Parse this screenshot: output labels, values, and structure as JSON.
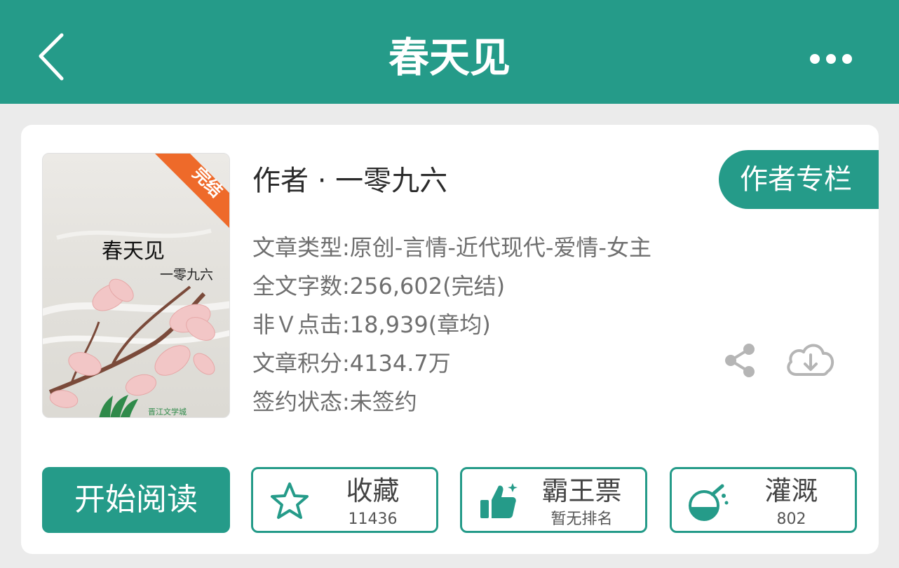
{
  "header": {
    "title": "春天见"
  },
  "book": {
    "cover_title": "春天见",
    "cover_author": "一零九六",
    "cover_status_ribbon": "完结",
    "cover_publisher_logo": "晋江文学城",
    "author_line": "作者 · 一零九六",
    "author_column_button": "作者专栏",
    "meta": {
      "genre": "文章类型:原创-言情-近代现代-爱情-女主",
      "word_count": "全文字数:256,602(完结)",
      "clicks": "非Ｖ点击:18,939(章均)",
      "score": "文章积分:4134.7万",
      "contract": "签约状态:未签约"
    }
  },
  "actions": {
    "read_label": "开始阅读",
    "favorite": {
      "label": "收藏",
      "count": "11436"
    },
    "vote": {
      "label": "霸王票",
      "sub": "暂无排名"
    },
    "water": {
      "label": "灌溉",
      "count": "802"
    }
  },
  "icons": {
    "back": "back-chevron-icon",
    "more": "more-dots-icon",
    "share": "share-icon",
    "download": "cloud-download-icon",
    "favorite": "star-icon",
    "vote": "thumbs-up-icon",
    "water": "watering-flask-icon"
  },
  "colors": {
    "primary": "#259b89",
    "ribbon": "#ee6a2a",
    "background": "#ebebeb",
    "meta_text": "#6f6f6f"
  }
}
